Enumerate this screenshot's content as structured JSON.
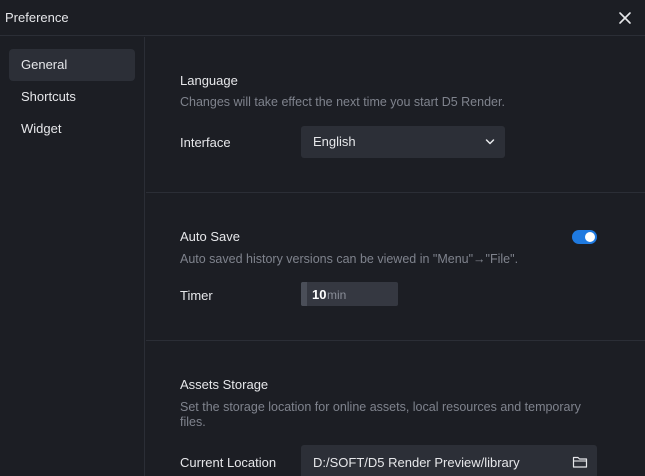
{
  "window": {
    "title": "Preference"
  },
  "sidebar": {
    "items": [
      {
        "label": "General",
        "active": true
      },
      {
        "label": "Shortcuts",
        "active": false
      },
      {
        "label": "Widget",
        "active": false
      }
    ]
  },
  "language": {
    "title": "Language",
    "description": "Changes will take effect the next time you start D5 Render.",
    "interface_label": "Interface",
    "interface_value": "English"
  },
  "autosave": {
    "title": "Auto Save",
    "description": "Auto saved history versions can be viewed in \"Menu\"→\"File\".",
    "enabled": true,
    "timer_label": "Timer",
    "timer_value": "10",
    "timer_unit": "min"
  },
  "assets": {
    "title": "Assets Storage",
    "description_line1": "Set the storage location for online assets, local resources and temporary",
    "description_line2": "files.",
    "location_label": "Current Location",
    "location_value": "D:/SOFT/D5 Render Preview/library"
  },
  "colors": {
    "background": "#1c1e24",
    "panel": "#2c2f37",
    "accent": "#1f7ae0",
    "muted_text": "#7f838d"
  },
  "icons": {
    "close": "close-icon",
    "chevron": "chevron-down-icon",
    "folder": "folder-icon"
  }
}
